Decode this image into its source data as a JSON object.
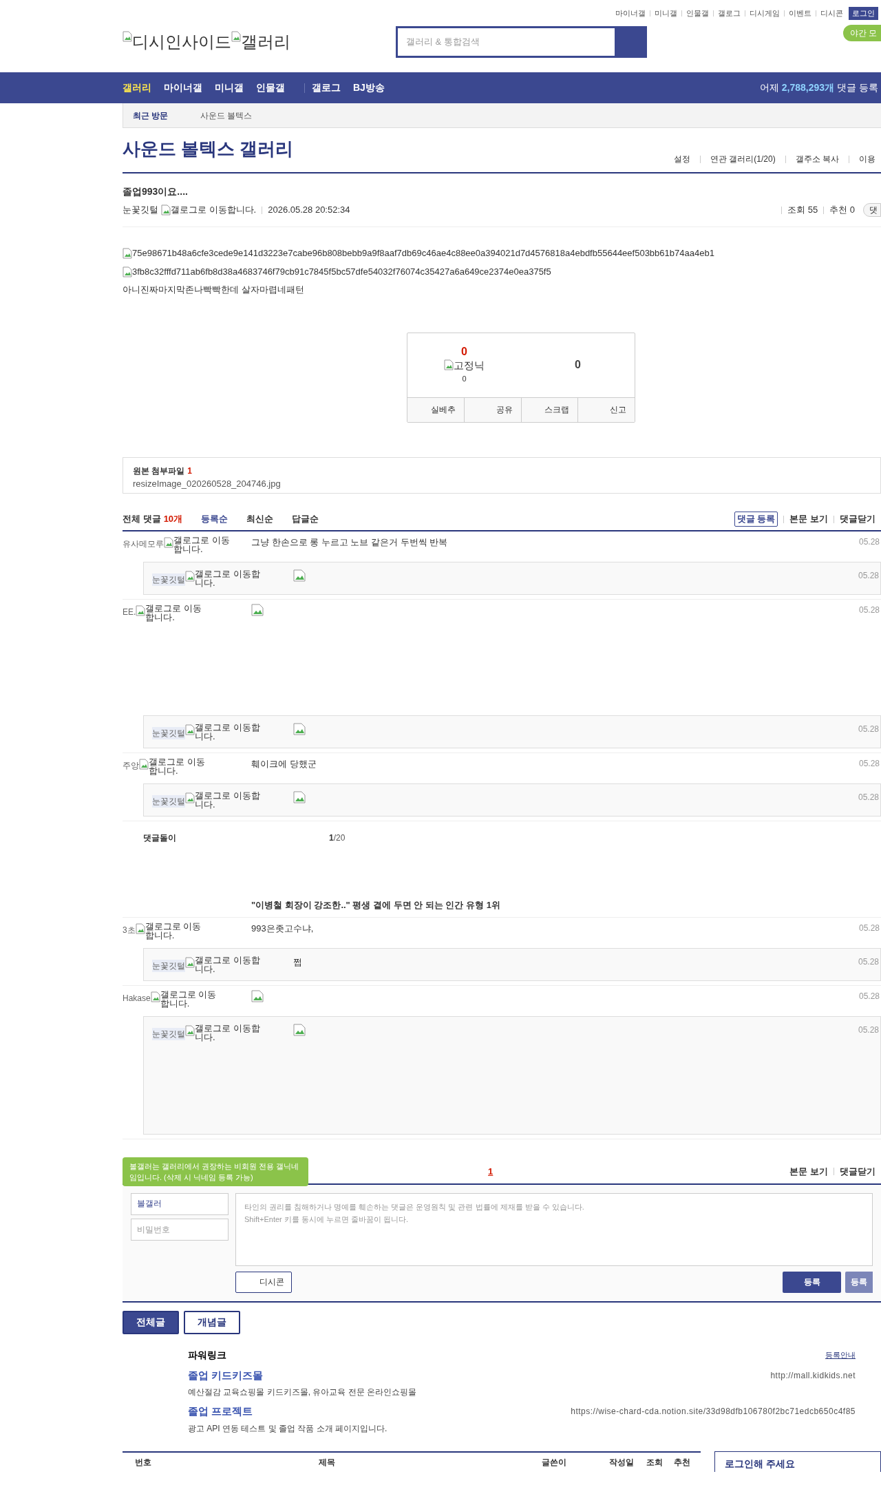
{
  "top_links": [
    "마이너갤",
    "미니갤",
    "인물갤",
    "갤로그",
    "디시게임",
    "이벤트",
    "디시콘"
  ],
  "login_button": "로그인",
  "night_mode": "야간 모",
  "logo": {
    "alt_1": "디시인사이드",
    "alt_2": "갤러리"
  },
  "search": {
    "placeholder": "갤러리 & 통합검색"
  },
  "nav": {
    "items": [
      {
        "label": "갤러리",
        "selected": true
      },
      {
        "label": "마이너갤",
        "selected": false
      },
      {
        "label": "미니갤",
        "selected": false
      },
      {
        "label": "인물갤",
        "selected": false
      },
      {
        "label": "갤로그",
        "selected": false
      },
      {
        "label": "BJ방송",
        "selected": false
      }
    ],
    "stat_prefix": "어제",
    "stat_count": "2,788,293개",
    "stat_suffix": "댓글 등록"
  },
  "recent": {
    "label": "최근 방문",
    "items": [
      "사운드 볼텍스"
    ]
  },
  "gallery": {
    "title": "사운드 볼텍스 갤러리",
    "links": [
      "설정",
      "연관 갤러리(1/20)",
      "갤주소 복사",
      "이용"
    ]
  },
  "post": {
    "title": "졸업993이요....",
    "author": "눈꽃깃털",
    "author_icon_alt": "갤로그로 이동합니다.",
    "date": "2026.05.28 20:52:34",
    "views": "조회 55",
    "recommend": "추천 0",
    "comment_button": "댓",
    "images": [
      "75e98671b48a6cfe3cede9e141d3223e7cabe96b808bebb9a9f8aaf7db69c46ae4c88ee0a394021d7d4576818a4ebdfb55644eef503bb61b74aa4eb1",
      "3fb8c32fffd711ab6fb8d38a4683746f79cb91c7845f5bc57dfe54032f76074c35427a6a649ce2374e0ea375f5"
    ],
    "body": "아니진짜마지막존나빡빡한데 살자마렵네패턴"
  },
  "vote": {
    "up_count": "0",
    "fixed_alt": "고정닉",
    "fixed_count": "0",
    "down_count": "0",
    "actions": [
      "실베추",
      "공유",
      "스크랩",
      "신고"
    ]
  },
  "attachment": {
    "label": "원본 첨부파일",
    "count": "1",
    "file": "resizeImage_020260528_204746.jpg"
  },
  "comments": {
    "total_label": "전체 댓글",
    "count": "10개",
    "sorts": [
      {
        "label": "등록순",
        "selected": true
      },
      {
        "label": "최신순",
        "selected": false
      },
      {
        "label": "답글순",
        "selected": false
      }
    ],
    "actions": [
      "댓글 등록",
      "본문 보기",
      "댓글닫기"
    ],
    "items": [
      {
        "kind": "comment",
        "nick": "유사메모루",
        "icon_alt": "갤로그로 이동합니다.",
        "content": {
          "kind": "text",
          "text": "그냥 한손으로 롱 누르고 노브 같은거 두번씩 반복",
          "large": false
        },
        "date": "05.28",
        "replies": [
          {
            "nick": "눈꽃깃털",
            "icon_alt": "갤로그로 이동합니다.",
            "content": {
              "kind": "image",
              "large": false
            },
            "date": "05.28"
          }
        ]
      },
      {
        "kind": "comment",
        "nick": "EE.",
        "icon_alt": "갤로그로 이동합니다.",
        "content": {
          "kind": "image",
          "large": true
        },
        "date": "05.28",
        "replies": [
          {
            "nick": "눈꽃깃털",
            "icon_alt": "갤로그로 이동합니다.",
            "content": {
              "kind": "image",
              "large": false
            },
            "date": "05.28"
          }
        ]
      },
      {
        "kind": "comment",
        "nick": "주앙",
        "icon_alt": "갤로그로 이동합니다.",
        "content": {
          "kind": "text",
          "text": "훼이크에 당했군",
          "large": false
        },
        "date": "05.28",
        "replies": [
          {
            "nick": "눈꽃깃털",
            "icon_alt": "갤로그로 이동합니다.",
            "content": {
              "kind": "image",
              "large": false
            },
            "date": "05.28"
          }
        ]
      },
      {
        "kind": "bot",
        "nick": "댓글돌이",
        "page": "1",
        "page_total": "/20",
        "headline": "\"이병철 회장이 강조한..\" 평생 곁에 두면 안 되는 인간 유형 1위"
      },
      {
        "kind": "comment",
        "nick": "3초",
        "icon_alt": "갤로그로 이동합니다.",
        "content": {
          "kind": "text",
          "text": "993은좃고수냐,",
          "large": false
        },
        "date": "05.28",
        "replies": [
          {
            "nick": "눈꽃깃털",
            "icon_alt": "갤로그로 이동합니다.",
            "content": {
              "kind": "text",
              "text": "쩝",
              "large": false
            },
            "date": "05.28"
          }
        ]
      },
      {
        "kind": "comment",
        "nick": "Hakase",
        "icon_alt": "갤로그로 이동합니다.",
        "content": {
          "kind": "image",
          "large": false
        },
        "date": "05.28",
        "replies": [
          {
            "nick": "눈꽃깃털",
            "icon_alt": "갤로그로 이동합니다.",
            "content": {
              "kind": "image",
              "large": true
            },
            "date": "05.28"
          }
        ]
      }
    ]
  },
  "pagination": {
    "pages": [
      {
        "label": "1",
        "selected": true
      }
    ]
  },
  "bottom_actions": [
    "본문 보기",
    "댓글닫기"
  ],
  "tooltip": "볼갤러는 갤러리에서 권장하는 비회원 전용 갤닉네임입니다. (삭제 시 닉네임 등록 가능)",
  "form": {
    "nick_value": "볼갤러",
    "password_placeholder": "비밀번호",
    "textarea_placeholder": "타인의 권리를 침해하거나 명예를 훼손하는 댓글은 운영원칙 및 관련 법률에 제재를 받을 수 있습니다.\nShift+Enter 키를 동시에 누르면 줄바꿈이 됩니다.",
    "dccon_button": "디시콘",
    "submit": "등록",
    "submit_secondary": "등록"
  },
  "list_tabs": [
    {
      "label": "전체글",
      "selected": true
    },
    {
      "label": "개념글",
      "selected": false
    }
  ],
  "powerlink": {
    "title": "파워링크",
    "guide": "등록안내",
    "ads": [
      {
        "title": "졸업 키드키즈몰",
        "url": "http://mall.kidkids.net",
        "desc": "예산절감 교육쇼핑몰 키드키즈몰, 유아교육 전문 온라인쇼핑몰"
      },
      {
        "title": "졸업 프로젝트",
        "url": "https://wise-chard-cda.notion.site/33d98dfb106780f2bc71edcb650c4f85",
        "desc": "광고 API 연동 테스트 및 졸업 작품 소개 페이지입니다."
      }
    ]
  },
  "table": {
    "columns": [
      "번호",
      "제목",
      "글쓴이",
      "작성일",
      "조회",
      "추천"
    ]
  },
  "login_box": {
    "title": "로그인해 주세요"
  }
}
